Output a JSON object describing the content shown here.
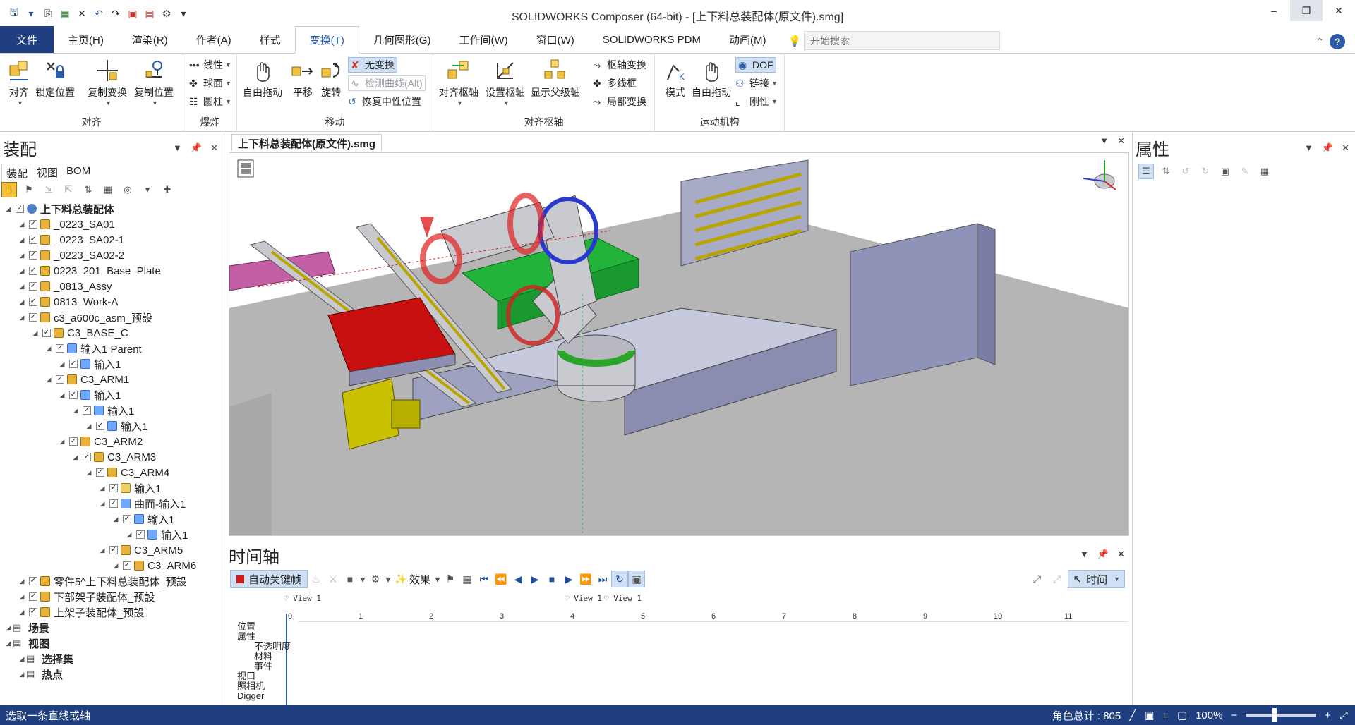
{
  "window": {
    "title": "SOLIDWORKS Composer (64-bit) - [上下料总装配体(原文件).smg]"
  },
  "menubar": {
    "file": "文件",
    "tabs": [
      "主页(H)",
      "渲染(R)",
      "作者(A)",
      "样式",
      "变换(T)",
      "几何图形(G)",
      "工作间(W)",
      "窗口(W)",
      "SOLIDWORKS PDM",
      "动画(M)"
    ],
    "active_tab_index": 4,
    "search_placeholder": "开始搜索"
  },
  "ribbon": {
    "align": {
      "label": "对齐",
      "buttons": [
        "对齐",
        "锁定位置",
        "复制变换",
        "复制位置"
      ]
    },
    "explode": {
      "label": "爆炸",
      "buttons": [
        "线性",
        "球面",
        "圆柱"
      ]
    },
    "move": {
      "label": "移动",
      "buttons": [
        "自由拖动",
        "平移",
        "旋转"
      ],
      "small": [
        "无变换",
        "检测曲线(Alt)",
        "恢复中性位置"
      ]
    },
    "pivot": {
      "label": "对齐枢轴",
      "buttons": [
        "对齐枢轴",
        "设置枢轴",
        "显示父级轴"
      ],
      "small": [
        "枢轴变换",
        "多线框",
        "局部变换"
      ]
    },
    "kinematics": {
      "label": "运动机构",
      "buttons": [
        "模式",
        "自由拖动"
      ],
      "small": [
        "DOF",
        "链接",
        "刚性"
      ]
    }
  },
  "assembly_panel": {
    "title": "装配",
    "tabs": [
      "装配",
      "视图",
      "BOM"
    ],
    "tree": [
      {
        "label": "上下料总装配体",
        "level": 0,
        "bold": true,
        "icon": "root"
      },
      {
        "label": "_0223_SA01",
        "level": 1,
        "icon": "asm"
      },
      {
        "label": "_0223_SA02-1",
        "level": 1,
        "icon": "asm"
      },
      {
        "label": "_0223_SA02-2",
        "level": 1,
        "icon": "asm"
      },
      {
        "label": "0223_201_Base_Plate",
        "level": 1,
        "icon": "asm"
      },
      {
        "label": "_0813_Assy",
        "level": 1,
        "icon": "asm"
      },
      {
        "label": "0813_Work-A",
        "level": 1,
        "icon": "asm"
      },
      {
        "label": "c3_a600c_asm_预設",
        "level": 1,
        "icon": "asm"
      },
      {
        "label": "C3_BASE_C",
        "level": 2,
        "icon": "asm"
      },
      {
        "label": "输入1 Parent",
        "level": 3,
        "icon": "kin"
      },
      {
        "label": "输入1",
        "level": 4,
        "icon": "kin"
      },
      {
        "label": "C3_ARM1",
        "level": 3,
        "icon": "asm"
      },
      {
        "label": "输入1",
        "level": 4,
        "icon": "kin"
      },
      {
        "label": "输入1",
        "level": 5,
        "icon": "kin"
      },
      {
        "label": "输入1",
        "level": 6,
        "icon": "kin"
      },
      {
        "label": "C3_ARM2",
        "level": 4,
        "icon": "asm"
      },
      {
        "label": "C3_ARM3",
        "level": 5,
        "icon": "asm"
      },
      {
        "label": "C3_ARM4",
        "level": 6,
        "icon": "asm"
      },
      {
        "label": "输入1",
        "level": 7,
        "icon": "part"
      },
      {
        "label": "曲面-输入1",
        "level": 7,
        "icon": "kin"
      },
      {
        "label": "输入1",
        "level": 8,
        "icon": "kin"
      },
      {
        "label": "输入1",
        "level": 9,
        "icon": "kin"
      },
      {
        "label": "C3_ARM5",
        "level": 7,
        "icon": "asm"
      },
      {
        "label": "C3_ARM6",
        "level": 8,
        "icon": "asm"
      },
      {
        "label": "零件5^上下料总装配体_预設",
        "level": 1,
        "icon": "asm"
      },
      {
        "label": "下部架子装配体_预設",
        "level": 1,
        "icon": "asm"
      },
      {
        "label": "上架子装配体_预設",
        "level": 1,
        "icon": "asm"
      },
      {
        "label": "场景",
        "level": 0,
        "bold": true,
        "icon": "none"
      },
      {
        "label": "视图",
        "level": 0,
        "bold": true,
        "icon": "none"
      },
      {
        "label": "选择集",
        "level": 1,
        "bold": true,
        "icon": "none"
      },
      {
        "label": "热点",
        "level": 1,
        "bold": true,
        "icon": "none"
      }
    ]
  },
  "document": {
    "tab": "上下料总装配体(原文件).smg"
  },
  "timeline": {
    "title": "时间轴",
    "auto_key": "自动关键帧",
    "effects": "效果",
    "time_mode": "时间",
    "view_markers": [
      "View 1",
      "View 1",
      "View 1"
    ],
    "ruler": [
      "0",
      "1",
      "2",
      "3",
      "4",
      "5",
      "6",
      "7",
      "8",
      "9",
      "10",
      "11"
    ],
    "tracks": [
      "位置",
      "属性",
      "不透明度",
      "材料",
      "事件",
      "视口",
      "照相机",
      "Digger"
    ]
  },
  "properties_panel": {
    "title": "属性"
  },
  "status": {
    "message": "选取一条直线或轴",
    "actor_count": "角色总计 : 805",
    "zoom": "100%"
  }
}
